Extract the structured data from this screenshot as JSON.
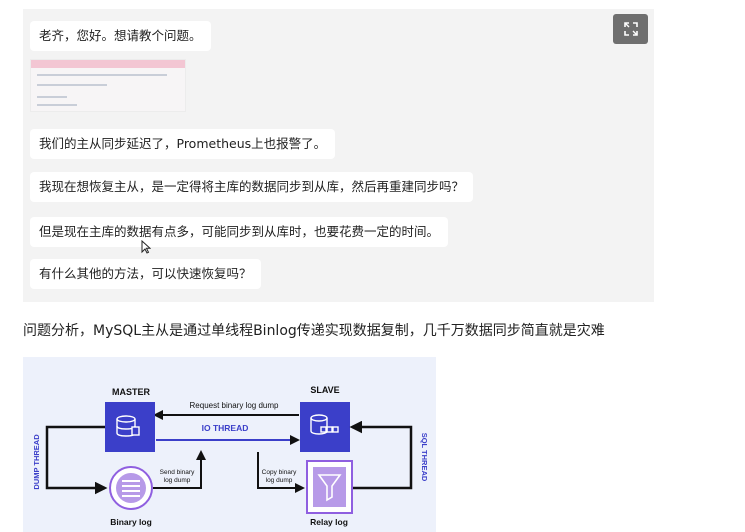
{
  "chat": {
    "messages": [
      "老齐，您好。想请教个问题。",
      "我们的主从同步延迟了，Prometheus上也报警了。",
      "我现在想恢复主从，是一定得将主库的数据同步到从库，然后再重建同步吗？",
      "但是现在主库的数据有点多，可能同步到从库时，也要花费一定的时间。",
      "有什么其他的方法，可以快速恢复吗？"
    ],
    "expand_icon": "expand-icon"
  },
  "analysis_text": "问题分析，MySQL主从是通过单线程Binlog传递实现数据复制，几千万数据同步简直就是灾难",
  "diagram": {
    "master_label": "MASTER",
    "slave_label": "SLAVE",
    "request_label": "Request binary log dump",
    "io_thread_label": "IO THREAD",
    "dump_thread_label": "DUMP THREAD",
    "sql_thread_label": "SQL THREAD",
    "send_label_1": "Send binary",
    "send_label_2": "log dump",
    "copy_label_1": "Copy binary",
    "copy_label_2": "log dump",
    "binary_log_label": "Binary log",
    "relay_log_label": "Relay log",
    "colors": {
      "accent": "#3b3fc9",
      "light": "#8f5fe0",
      "line": "#111111"
    }
  }
}
